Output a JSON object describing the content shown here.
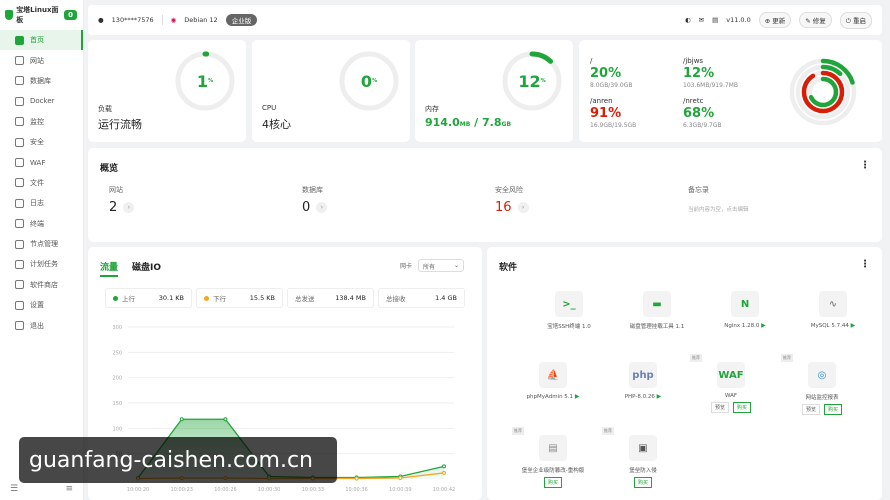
{
  "brand": {
    "name": "宝塔Linux面板",
    "badge": "0"
  },
  "nav": [
    "首页",
    "网站",
    "数据库",
    "Docker",
    "监控",
    "安全",
    "WAF",
    "文件",
    "日志",
    "终端",
    "节点管理",
    "计划任务",
    "软件商店",
    "设置",
    "退出"
  ],
  "topbar": {
    "user": "130****7576",
    "os": "Debian 12",
    "edition": "企业版",
    "version": "v11.0.0",
    "update": "更新",
    "repair": "修复",
    "restart": "重启"
  },
  "gauges": [
    {
      "value": "1",
      "unit": "%",
      "label": "负载",
      "status": "运行流畅",
      "fraction": 0.01
    },
    {
      "value": "0",
      "unit": "%",
      "label": "CPU",
      "status": "4核心",
      "fraction": 0.0
    },
    {
      "value": "12",
      "unit": "%",
      "label": "内存",
      "status_num": "914.0",
      "status_unit": "MB",
      "status_sep": " / ",
      "status_total": "7.8",
      "status_total_unit": "GB",
      "fraction": 0.12
    }
  ],
  "disks": [
    {
      "path": "/",
      "pct": "20%",
      "size": "8.0GB/39.0GB",
      "color": "#20a53a"
    },
    {
      "path": "/jbjws",
      "pct": "12%",
      "size": "103.6MB/919.7MB",
      "color": "#20a53a"
    },
    {
      "path": "/anren",
      "pct": "91%",
      "size": "16.9GB/19.5GB",
      "color": "#d81e06"
    },
    {
      "path": "/nretc",
      "pct": "68%",
      "size": "6.3GB/9.7GB",
      "color": "#20a53a"
    }
  ],
  "overview": {
    "title": "概览",
    "items": [
      {
        "label": "网站",
        "value": "2"
      },
      {
        "label": "数据库",
        "value": "0"
      },
      {
        "label": "安全风险",
        "value": "16"
      },
      {
        "label": "备忘录",
        "memo": "当前内容为空，点击编辑"
      }
    ]
  },
  "traffic": {
    "tab1": "流量",
    "tab2": "磁盘IO",
    "nic_label": "网卡",
    "nic_value": "所有",
    "stats": [
      {
        "label": "上行",
        "value": "30.1 KB",
        "color": "#20a53a"
      },
      {
        "label": "下行",
        "value": "15.5 KB",
        "color": "#f5a623"
      },
      {
        "label": "总发送",
        "value": "138.4 MB"
      },
      {
        "label": "总接收",
        "value": "1.4 GB"
      }
    ]
  },
  "chart_data": {
    "type": "area",
    "y_ticks": [
      "300",
      "250",
      "200",
      "150",
      "100",
      "50"
    ],
    "ylim": [
      0,
      300
    ],
    "categories": [
      "10:00:20",
      "10:00:23",
      "10:00:26",
      "10:00:29",
      "10:00:33",
      "10:00:36",
      "10:00:39",
      "10:00:42"
    ],
    "x_ticks": [
      "10:00:20",
      "10:00:23",
      "10:00:26",
      "10:00:30",
      "10:00:33",
      "10:00:36",
      "10:00:39",
      "10:00:42"
    ],
    "series": [
      {
        "name": "上行",
        "color": "#20a53a",
        "values": [
          2,
          118,
          118,
          5,
          3,
          3,
          5,
          25
        ]
      },
      {
        "name": "下行",
        "color": "#f5a623",
        "values": [
          1,
          2,
          2,
          1,
          1,
          1,
          2,
          12
        ]
      }
    ]
  },
  "software": {
    "title": "软件",
    "items": [
      {
        "name": "宝塔SSH终端 1.0",
        "icon": ">_",
        "color": "#20a53a"
      },
      {
        "name": "磁盘管理挂载工具 1.1",
        "icon": "▬",
        "color": "#20a53a"
      },
      {
        "name": "Nginx 1.28.0",
        "icon": "N",
        "color": "#20a53a",
        "play": "▶"
      },
      {
        "name": "MySQL 5.7.44",
        "icon": "∿",
        "color": "#888",
        "play": "▶"
      },
      {
        "name": "phpMyAdmin 5.1",
        "icon": "⛵",
        "color": "#c87a1a",
        "play": "▶"
      },
      {
        "name": "PHP-8.0.26",
        "icon": "php",
        "color": "#6b7fb5",
        "play": "▶"
      },
      {
        "name": "WAF",
        "icon": "WAF",
        "color": "#20a53a",
        "tag": "推荐",
        "b1": "预览",
        "b2": "购买"
      },
      {
        "name": "网站监控报表",
        "icon": "◎",
        "color": "#2a8bd8",
        "tag": "推荐",
        "b1": "预览",
        "b2": "购买"
      },
      {
        "name": "堡垒企业级防篡改-重构版",
        "icon": "▤",
        "color": "#888",
        "tag": "推荐",
        "b2": "购买"
      },
      {
        "name": "堡垒防入侵",
        "icon": "▣",
        "color": "#555",
        "tag": "推荐",
        "b2": "购买"
      }
    ]
  },
  "watermark": "guanfang-caishen.com.cn"
}
